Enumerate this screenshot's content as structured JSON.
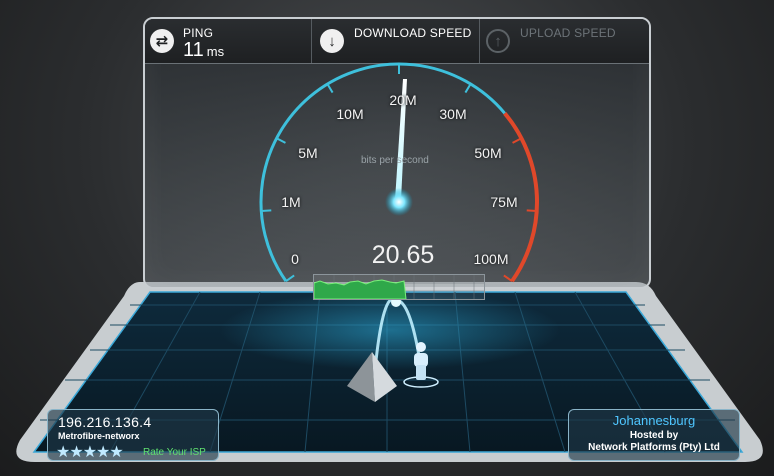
{
  "header": {
    "ping": {
      "label": "PING",
      "value": "11",
      "unit": "ms",
      "icon": "swap-arrows-icon"
    },
    "download": {
      "label": "DOWNLOAD SPEED",
      "icon": "arrow-down-icon"
    },
    "upload": {
      "label": "UPLOAD SPEED",
      "icon": "arrow-up-icon"
    }
  },
  "gauge": {
    "ticks": [
      "0",
      "1M",
      "5M",
      "10M",
      "20M",
      "30M",
      "50M",
      "75M",
      "100M"
    ],
    "units_label": "bits per second",
    "current_value": 20.65,
    "current_display": "20.65",
    "accent_color": "#3ec0dc",
    "hot_color": "#e0482a"
  },
  "client": {
    "ip": "196.216.136.4",
    "isp": "Metrofibre-networx",
    "stars": "★★★★★",
    "rate_label": "Rate Your ISP"
  },
  "server": {
    "city": "Johannesburg",
    "hosted_label": "Hosted by",
    "host": "Network Platforms (Pty) Ltd"
  }
}
